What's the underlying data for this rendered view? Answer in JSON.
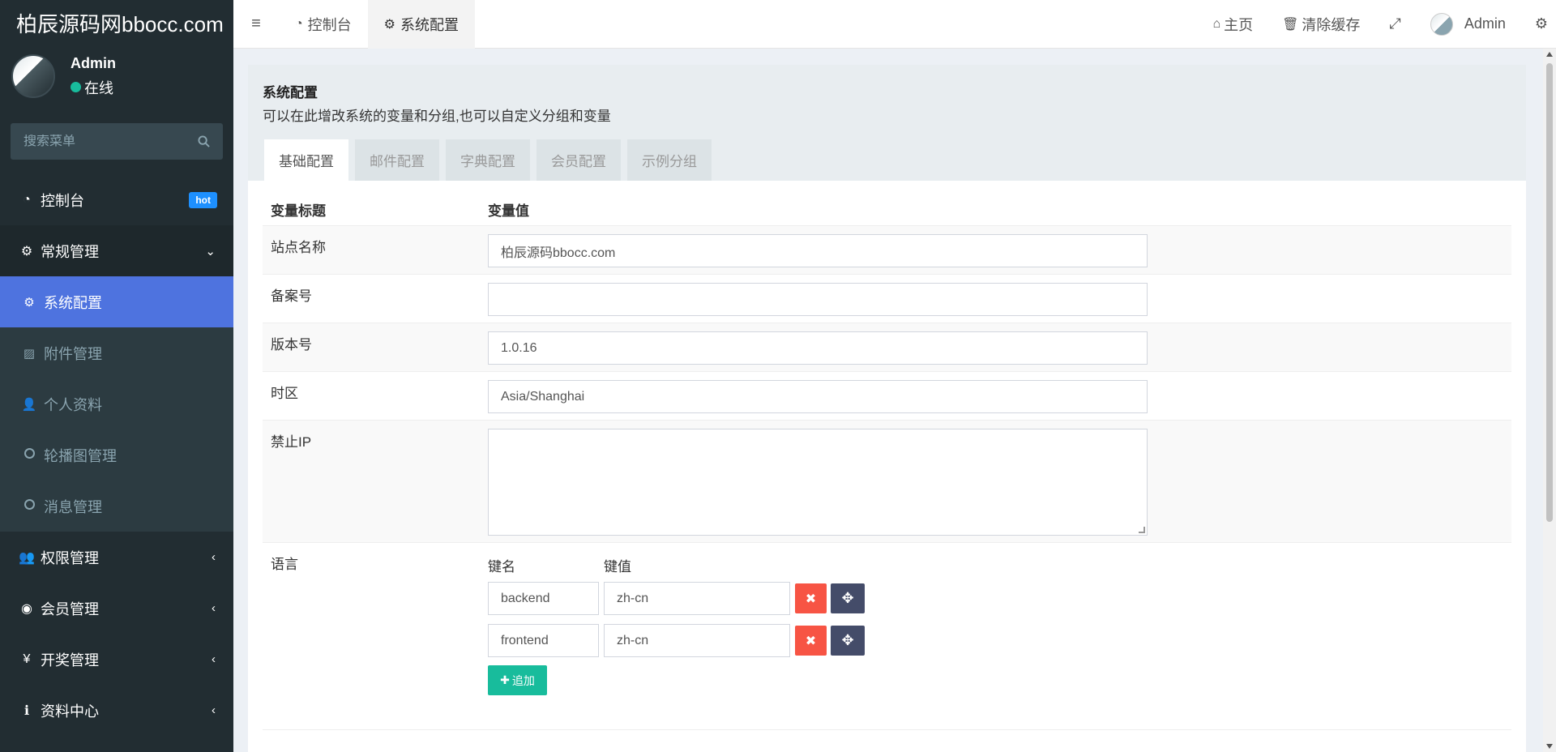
{
  "app": {
    "logo": "柏辰源码网bbocc.com"
  },
  "user": {
    "name": "Admin",
    "status": "在线"
  },
  "sidebar": {
    "search_placeholder": "搜索菜单",
    "items": [
      {
        "label": "控制台",
        "icon": "dashboard-icon",
        "badge": "hot"
      },
      {
        "label": "常规管理",
        "icon": "cogs-icon",
        "expanded": true,
        "children": [
          {
            "label": "系统配置",
            "icon": "gear-icon",
            "active": true
          },
          {
            "label": "附件管理",
            "icon": "image-icon"
          },
          {
            "label": "个人资料",
            "icon": "user-icon"
          },
          {
            "label": "轮播图管理",
            "icon": "circle-o-icon"
          },
          {
            "label": "消息管理",
            "icon": "circle-o-icon"
          }
        ]
      },
      {
        "label": "权限管理",
        "icon": "group-icon"
      },
      {
        "label": "会员管理",
        "icon": "user-circle-icon"
      },
      {
        "label": "开奖管理",
        "icon": "yen-icon"
      },
      {
        "label": "资料中心",
        "icon": "info-circle-icon"
      }
    ]
  },
  "header": {
    "tabs": [
      {
        "label": "控制台",
        "icon": "dashboard-icon"
      },
      {
        "label": "系统配置",
        "icon": "gear-icon",
        "active": true
      }
    ],
    "home": "主页",
    "clear_cache": "清除缓存",
    "user": "Admin"
  },
  "panel": {
    "title": "系统配置",
    "description": "可以在此增改系统的变量和分组,也可以自定义分组和变量",
    "tabs": [
      "基础配置",
      "邮件配置",
      "字典配置",
      "会员配置",
      "示例分组"
    ],
    "columns": {
      "title": "变量标题",
      "value": "变量值"
    },
    "rows": [
      {
        "label": "站点名称",
        "value": "柏辰源码bbocc.com"
      },
      {
        "label": "备案号",
        "value": ""
      },
      {
        "label": "版本号",
        "value": "1.0.16"
      },
      {
        "label": "时区",
        "value": "Asia/Shanghai"
      },
      {
        "label": "禁止IP",
        "value": ""
      }
    ],
    "language": {
      "label": "语言",
      "key_header": "键名",
      "value_header": "键值",
      "pairs": [
        {
          "key": "backend",
          "value": "zh-cn"
        },
        {
          "key": "frontend",
          "value": "zh-cn"
        }
      ],
      "add_label": "追加"
    }
  },
  "colors": {
    "sidebar_bg": "#222d32",
    "active_menu": "#4e73df",
    "danger": "#f75444",
    "success": "#18bc9c",
    "dark_btn": "#444c69"
  }
}
